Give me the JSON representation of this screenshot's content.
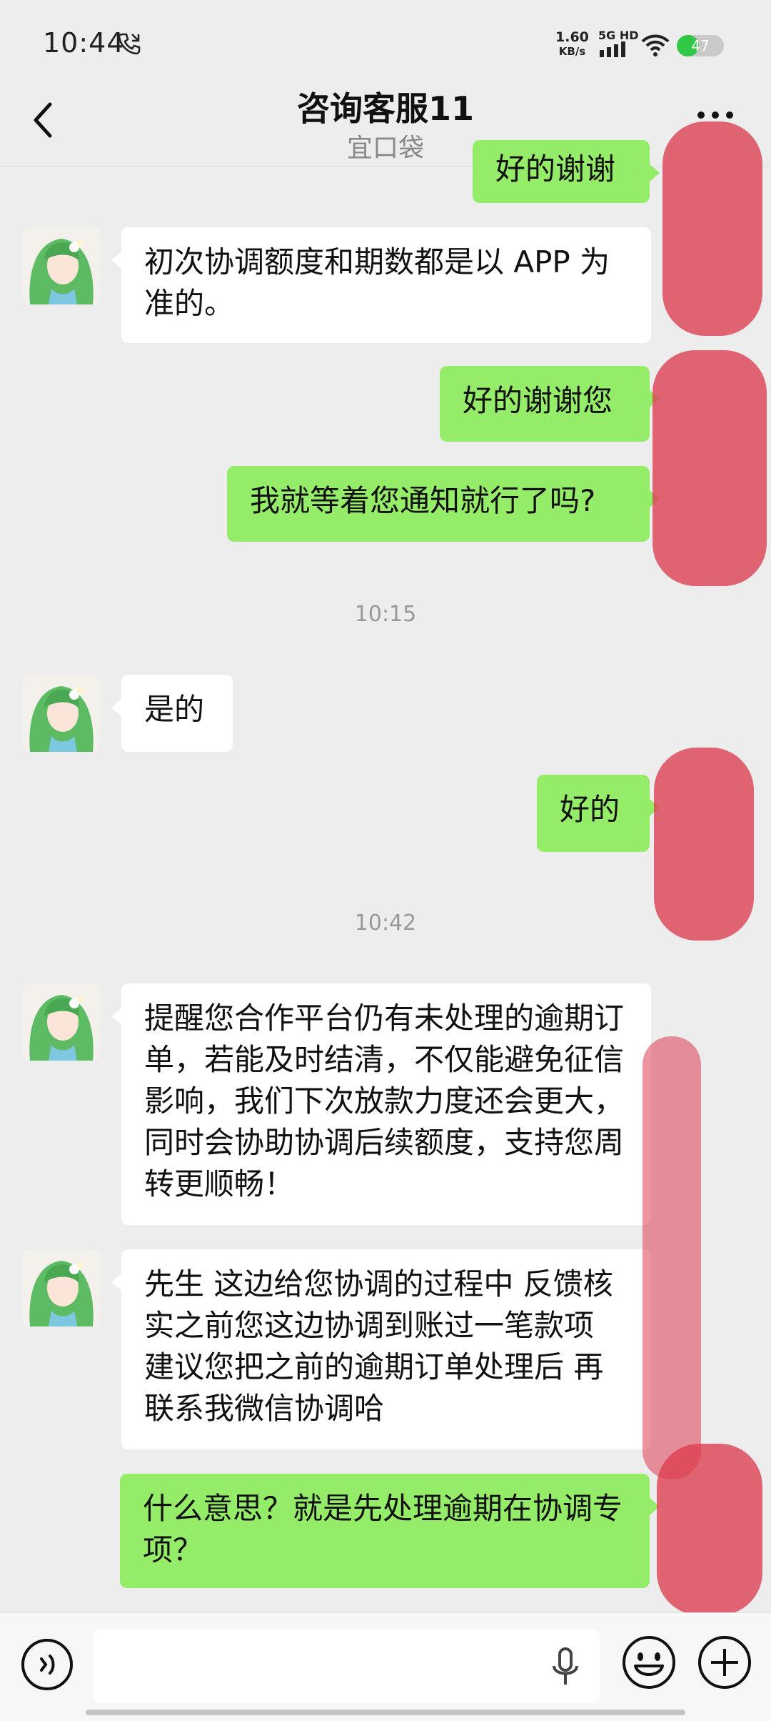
{
  "status_bar": {
    "time": "10:44",
    "net_speed_value": "1.60",
    "net_speed_unit": "KB/s",
    "network_label": "5G HD",
    "battery_level": "47",
    "battery_percent": 47
  },
  "header": {
    "title": "咨询客服11",
    "subtitle": "宜口袋"
  },
  "messages": [
    {
      "side": "right",
      "text": "好的谢谢"
    },
    {
      "side": "left",
      "text": "初次协调额度和期数都是以 APP 为准的。"
    },
    {
      "side": "right",
      "text": "好的谢谢您"
    },
    {
      "side": "right",
      "text": "我就等着您通知就行了吗?"
    },
    {
      "side": "left",
      "text": "是的"
    },
    {
      "side": "right",
      "text": "好的"
    },
    {
      "side": "left",
      "text": "提醒您合作平台仍有未处理的逾期订单，若能及时结清，不仅能避免征信影响，我们下次放款力度还会更大，同时会协助协调后续额度，支持您周转更顺畅！"
    },
    {
      "side": "left",
      "text": "先生  这边给您协调的过程中 反馈核实之前您这边协调到账过一笔款项  建议您把之前的逾期订单处理后 再联系我微信协调哈"
    },
    {
      "side": "right",
      "text": "什么意思？就是先处理逾期在协调专项？"
    }
  ],
  "timestamps": [
    "10:15",
    "10:42"
  ],
  "input_bar": {
    "placeholder": ""
  },
  "colors": {
    "background": "#ededed",
    "own_bubble": "#95ec69",
    "other_bubble": "#ffffff",
    "redaction": "#dc3c50"
  },
  "icons": {
    "back": "chevron-left-icon",
    "more": "more-dots-icon",
    "voice": "voice-icon",
    "mic": "mic-icon",
    "emoji": "emoji-icon",
    "plus": "plus-icon"
  }
}
